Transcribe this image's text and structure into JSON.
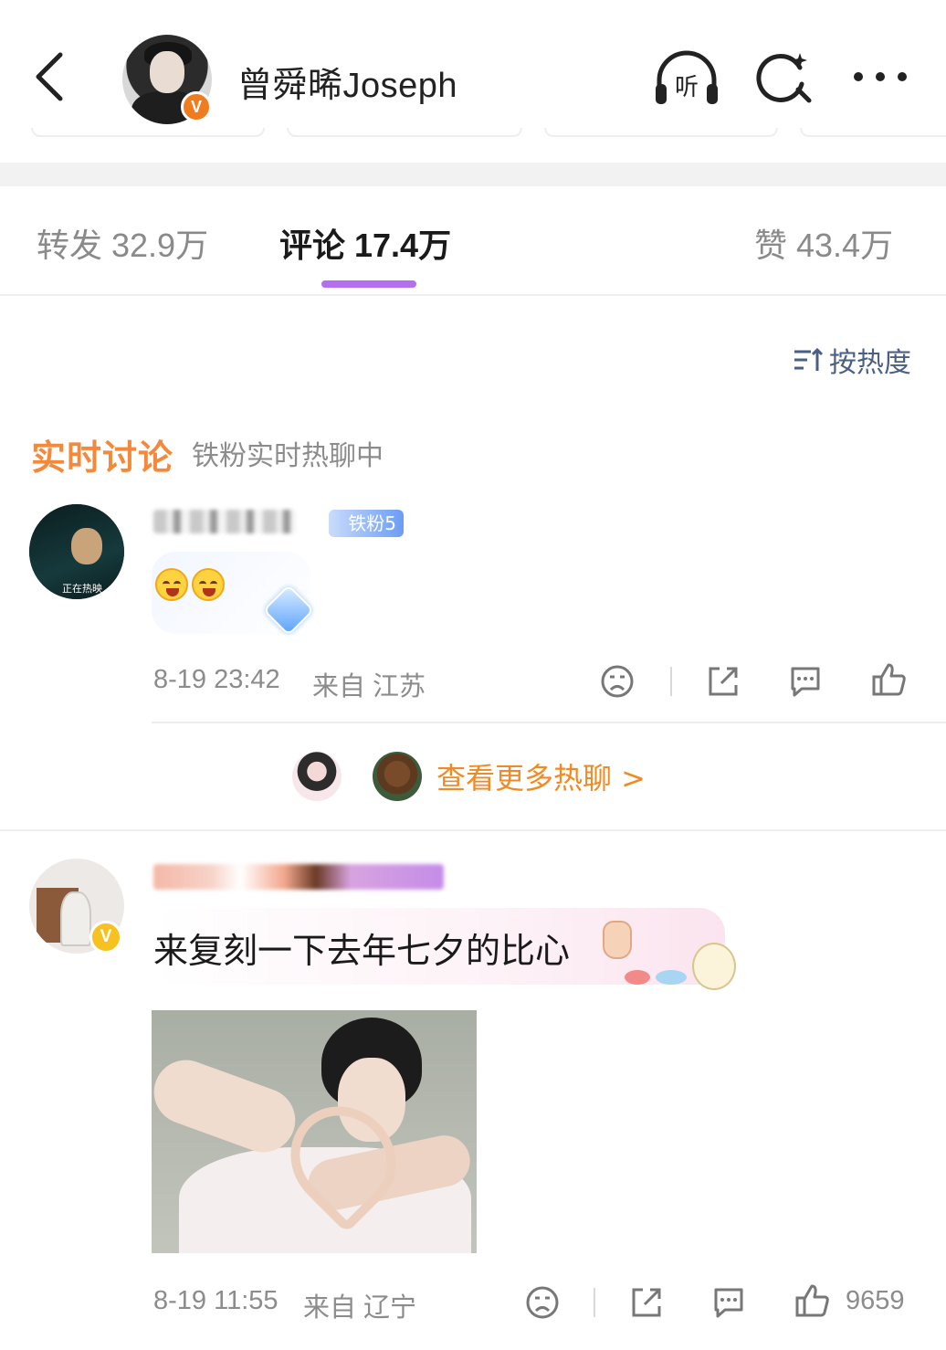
{
  "header": {
    "user_name": "曾舜晞Joseph",
    "listen_label": "听",
    "verified_mark": "V"
  },
  "stats_tabs": {
    "repost": "转发 32.9万",
    "comments": "评论 17.4万",
    "likes": "赞 43.4万"
  },
  "sort": {
    "label": "按热度"
  },
  "live_discussion": {
    "title": "实时讨论",
    "subtitle": "铁粉实时热聊中",
    "comment": {
      "fan_badge": "铁粉5",
      "content": "",
      "time": "8-19 23:42",
      "location": "来自 江苏",
      "avatar_text": "正在热映"
    },
    "more_label": "查看更多热聊 >"
  },
  "comments": [
    {
      "content": "来复刻一下去年七夕的比心",
      "time": "8-19 11:55",
      "location": "来自 辽宁",
      "like_count": "9659",
      "verified_mark": "V"
    }
  ],
  "colors": {
    "accent_purple": "#b36ff0",
    "section_orange": "#f4893b",
    "link_orange": "#f08a24",
    "sort_blue": "#4a5f86",
    "meta_gray": "#8c8c8c"
  },
  "icons": [
    "back-arrow-icon",
    "listen-icon",
    "search-icon",
    "more-icon",
    "sort-icon",
    "dislike-icon",
    "share-icon",
    "comment-icon",
    "like-icon"
  ]
}
